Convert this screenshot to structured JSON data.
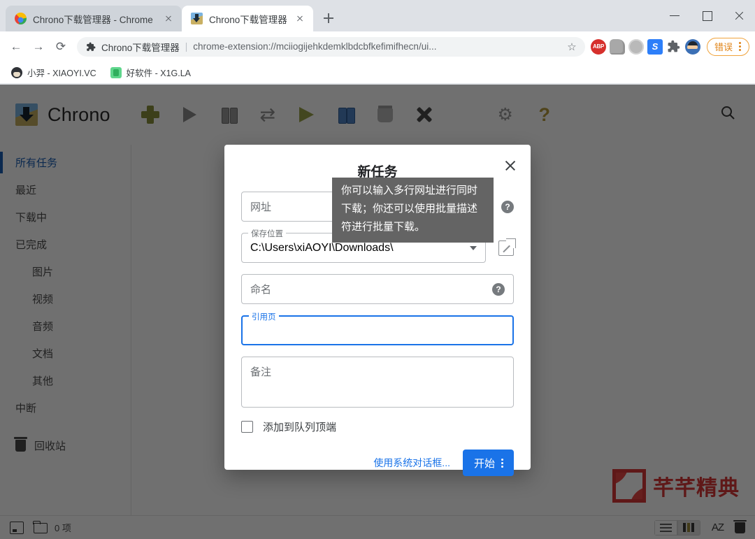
{
  "browser": {
    "tabs": [
      {
        "title": "Chrono下载管理器 - Chrome 网",
        "favicon": "chrome-icon",
        "active": false
      },
      {
        "title": "Chrono下载管理器",
        "favicon": "chrono-icon",
        "active": true
      }
    ],
    "new_tab_label": "+",
    "window_controls": {
      "minimize": "–",
      "maximize": "□",
      "close": "✕"
    },
    "nav": {
      "back": "←",
      "forward": "→",
      "reload": "⟳"
    },
    "omnibox": {
      "extension_name": "Chrono下载管理器",
      "separator": "|",
      "url": "chrome-extension://mciiogijehkdemklbdcbfkefimifhecn/ui...",
      "star": "☆"
    },
    "extensions": [
      {
        "name": "adblock-plus-icon",
        "label": "ABP"
      },
      {
        "name": "shoe-icon",
        "label": ""
      },
      {
        "name": "gray-circle-icon",
        "label": ""
      },
      {
        "name": "s-extension-icon",
        "label": "S"
      },
      {
        "name": "puzzle-icon",
        "label": ""
      },
      {
        "name": "profile-avatar",
        "label": ""
      }
    ],
    "error_badge": "错误",
    "bookmarks": [
      {
        "label": "小羿 - XIAOYI.VC",
        "icon": "avatar-icon"
      },
      {
        "label": "好软件 - X1G.LA",
        "icon": "green-app-icon"
      }
    ]
  },
  "app": {
    "brand": "Chrono",
    "toolbar": [
      {
        "name": "add-task-button",
        "icon": "plus-icon"
      },
      {
        "name": "start-button",
        "icon": "play-icon"
      },
      {
        "name": "pause-button",
        "icon": "pause-icon"
      },
      {
        "name": "retry-button",
        "icon": "refresh-icon"
      },
      {
        "name": "resume-all-button",
        "icon": "play-green-icon"
      },
      {
        "name": "pause-all-button",
        "icon": "pause-blue-icon"
      },
      {
        "name": "archive-button",
        "icon": "bin-icon"
      },
      {
        "name": "cancel-button",
        "icon": "x-icon"
      },
      {
        "name": "settings-button",
        "icon": "gear-icon"
      },
      {
        "name": "help-button",
        "icon": "question-icon"
      }
    ],
    "search_icon": "search-icon",
    "sidebar": [
      {
        "label": "所有任务",
        "active": true,
        "sub": false
      },
      {
        "label": "最近",
        "active": false,
        "sub": false
      },
      {
        "label": "下载中",
        "active": false,
        "sub": false
      },
      {
        "label": "已完成",
        "active": false,
        "sub": false
      },
      {
        "label": "图片",
        "active": false,
        "sub": true
      },
      {
        "label": "视频",
        "active": false,
        "sub": true
      },
      {
        "label": "音频",
        "active": false,
        "sub": true
      },
      {
        "label": "文档",
        "active": false,
        "sub": true
      },
      {
        "label": "其他",
        "active": false,
        "sub": true
      },
      {
        "label": "中断",
        "active": false,
        "sub": false
      }
    ],
    "trash_label": "回收站",
    "statusbar": {
      "count": "0 项",
      "thumbnail_icon": "image-thumb-icon",
      "folder_icon": "folder-icon",
      "view_list_icon": "list-view-icon",
      "view_grid_icon": "grid-view-icon",
      "sort_label": "AZ",
      "trash_icon": "trash-icon"
    },
    "watermark": "芊芊精典"
  },
  "dialog": {
    "title": "新任务",
    "close_icon": "close-icon",
    "url_placeholder": "网址",
    "url_help_icon": "help-icon",
    "tooltip": "你可以输入多行网址进行同时下载；你还可以使用批量描述符进行批量下载。",
    "save_location_label": "保存位置",
    "save_location_value": "C:\\Users\\xiAOYI\\Downloads\\",
    "browse_icon": "open-external-icon",
    "name_placeholder": "命名",
    "name_help_icon": "help-icon",
    "referrer_label": "引用页",
    "referrer_value": "",
    "notes_placeholder": "备注",
    "checkbox_label": "添加到队列顶端",
    "system_dialog_link": "使用系统对话框...",
    "start_button": "开始",
    "start_menu_icon": "kebab-icon"
  },
  "colors": {
    "accent": "#1a73e8",
    "sidebar_active": "#1a5fb4",
    "error_badge": "#e08519",
    "watermark": "#d8302f"
  }
}
